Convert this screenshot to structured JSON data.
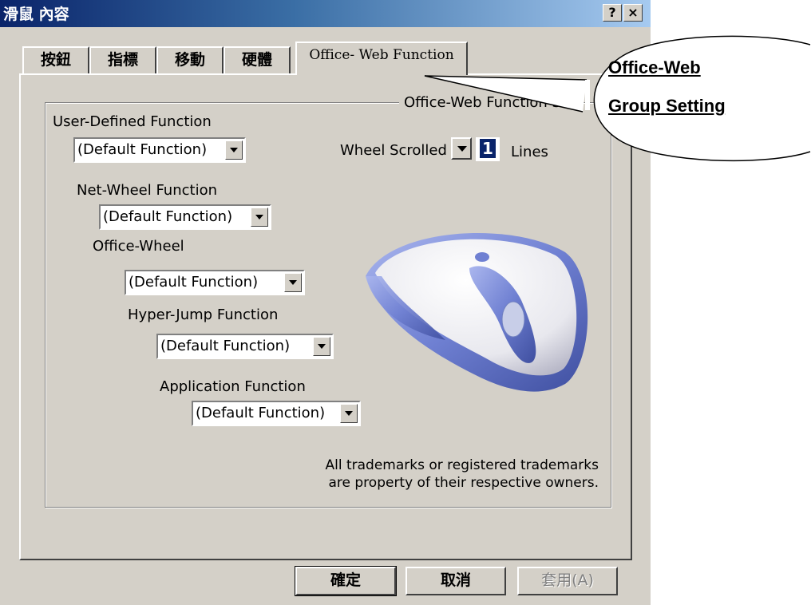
{
  "window": {
    "title": "滑鼠 內容",
    "help_label": "?",
    "close_label": "×"
  },
  "tabs": [
    {
      "label": "按鈕"
    },
    {
      "label": "指標"
    },
    {
      "label": "移動"
    },
    {
      "label": "硬體"
    },
    {
      "label": "Office- Web Function"
    }
  ],
  "group": {
    "title": "Office-Web Function Se"
  },
  "functions": {
    "user_defined_label": "User-Defined Function",
    "user_defined_value": "(Default Function)",
    "net_wheel_label": "Net-Wheel Function",
    "net_wheel_value": "(Default Function)",
    "office_wheel_label": "Office-Wheel",
    "office_wheel_value": "(Default Function)",
    "hyper_jump_label": "Hyper-Jump Function",
    "hyper_jump_value": "(Default Function)",
    "application_label": "Application Function",
    "application_value": "(Default Function)"
  },
  "wheel": {
    "scrolled_label": "Wheel Scrolled",
    "lines_value": "1",
    "lines_label": "Lines"
  },
  "trademark": {
    "line1": "All trademarks or registered trademarks",
    "line2": "are property of their respective owners."
  },
  "buttons": {
    "ok": "確定",
    "cancel": "取消",
    "apply": "套用(A)"
  },
  "callout": {
    "line1": "Office-Web",
    "line2": "Group Setting"
  },
  "colors": {
    "dialog_face": "#d4d0c8",
    "titlebar_start": "#0a246a",
    "mouse_body": "#f2f2f6",
    "mouse_accent": "#7f8fd8"
  }
}
